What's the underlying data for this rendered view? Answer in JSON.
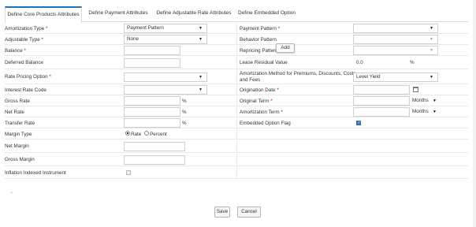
{
  "tabs": [
    {
      "label": "Define Core Products Attributes",
      "active": true
    },
    {
      "label": "Define Payment Attributes",
      "active": false
    },
    {
      "label": "Define Adjustable Rate Attributes",
      "active": false
    },
    {
      "label": "Define Embedded Option",
      "active": false
    }
  ],
  "left": {
    "amortization_type": {
      "label": "Amortization Type",
      "required": "*",
      "value": "Payment Pattern"
    },
    "adjustable_type": {
      "label": "Adjustable Type",
      "required": "*",
      "value": "None"
    },
    "balance": {
      "label": "Balance",
      "required": "*",
      "value": ""
    },
    "deferred_balance": {
      "label": "Deferred Balance",
      "value": ""
    },
    "rate_pricing_option": {
      "label": "Rate Pricing Option",
      "required": "*",
      "value": ""
    },
    "interest_rate_code": {
      "label": "Interest Rate Code",
      "value": ""
    },
    "gross_rate": {
      "label": "Gross Rate",
      "value": "",
      "suffix": "%"
    },
    "net_rate": {
      "label": "Net Rate",
      "value": "",
      "suffix": "%"
    },
    "transfer_rate": {
      "label": "Transfer Rate",
      "value": "",
      "suffix": "%"
    },
    "margin_type": {
      "label": "Margin Type",
      "option_rate": "Rate",
      "option_percent": "Percent",
      "selected": "Rate"
    },
    "net_margin": {
      "label": "Net Margin",
      "value": ""
    },
    "gross_margin": {
      "label": "Gross Margin",
      "value": ""
    },
    "inflation_indexed": {
      "label": "Inflation Indexed Instrument",
      "checked": false
    }
  },
  "right": {
    "payment_pattern": {
      "label": "Payment Pattern",
      "required": "*",
      "value": ""
    },
    "behavior_pattern": {
      "label": "Behavior Pattern",
      "value": ""
    },
    "repricing_pattern": {
      "label": "Repricing Pattern",
      "value": "",
      "add_label": "Add"
    },
    "lease_residual_value": {
      "label": "Lease Residual Value",
      "value": "0.0",
      "suffix": "%"
    },
    "amortization_method": {
      "label_line1": "Amortization Method for Premiums, Discounts, Costs",
      "label_line2": "and Fees",
      "value": "Level Yield"
    },
    "origination_date": {
      "label": "Origination Date",
      "required": "*",
      "value": ""
    },
    "original_term": {
      "label": "Original Term",
      "required": "*",
      "value": "",
      "unit": "Months"
    },
    "amortization_term": {
      "label": "Amortization Term",
      "required": "*",
      "value": "",
      "unit": "Months"
    },
    "embedded_option_flag": {
      "label": "Embedded Option Flag",
      "checked": true
    }
  },
  "footer": {
    "save_label": "Save",
    "cancel_label": "Cancel"
  },
  "colors": {
    "accent": "#1d6fb8",
    "required": "#d0021b",
    "checkbox_on": "#3b6fb6"
  }
}
